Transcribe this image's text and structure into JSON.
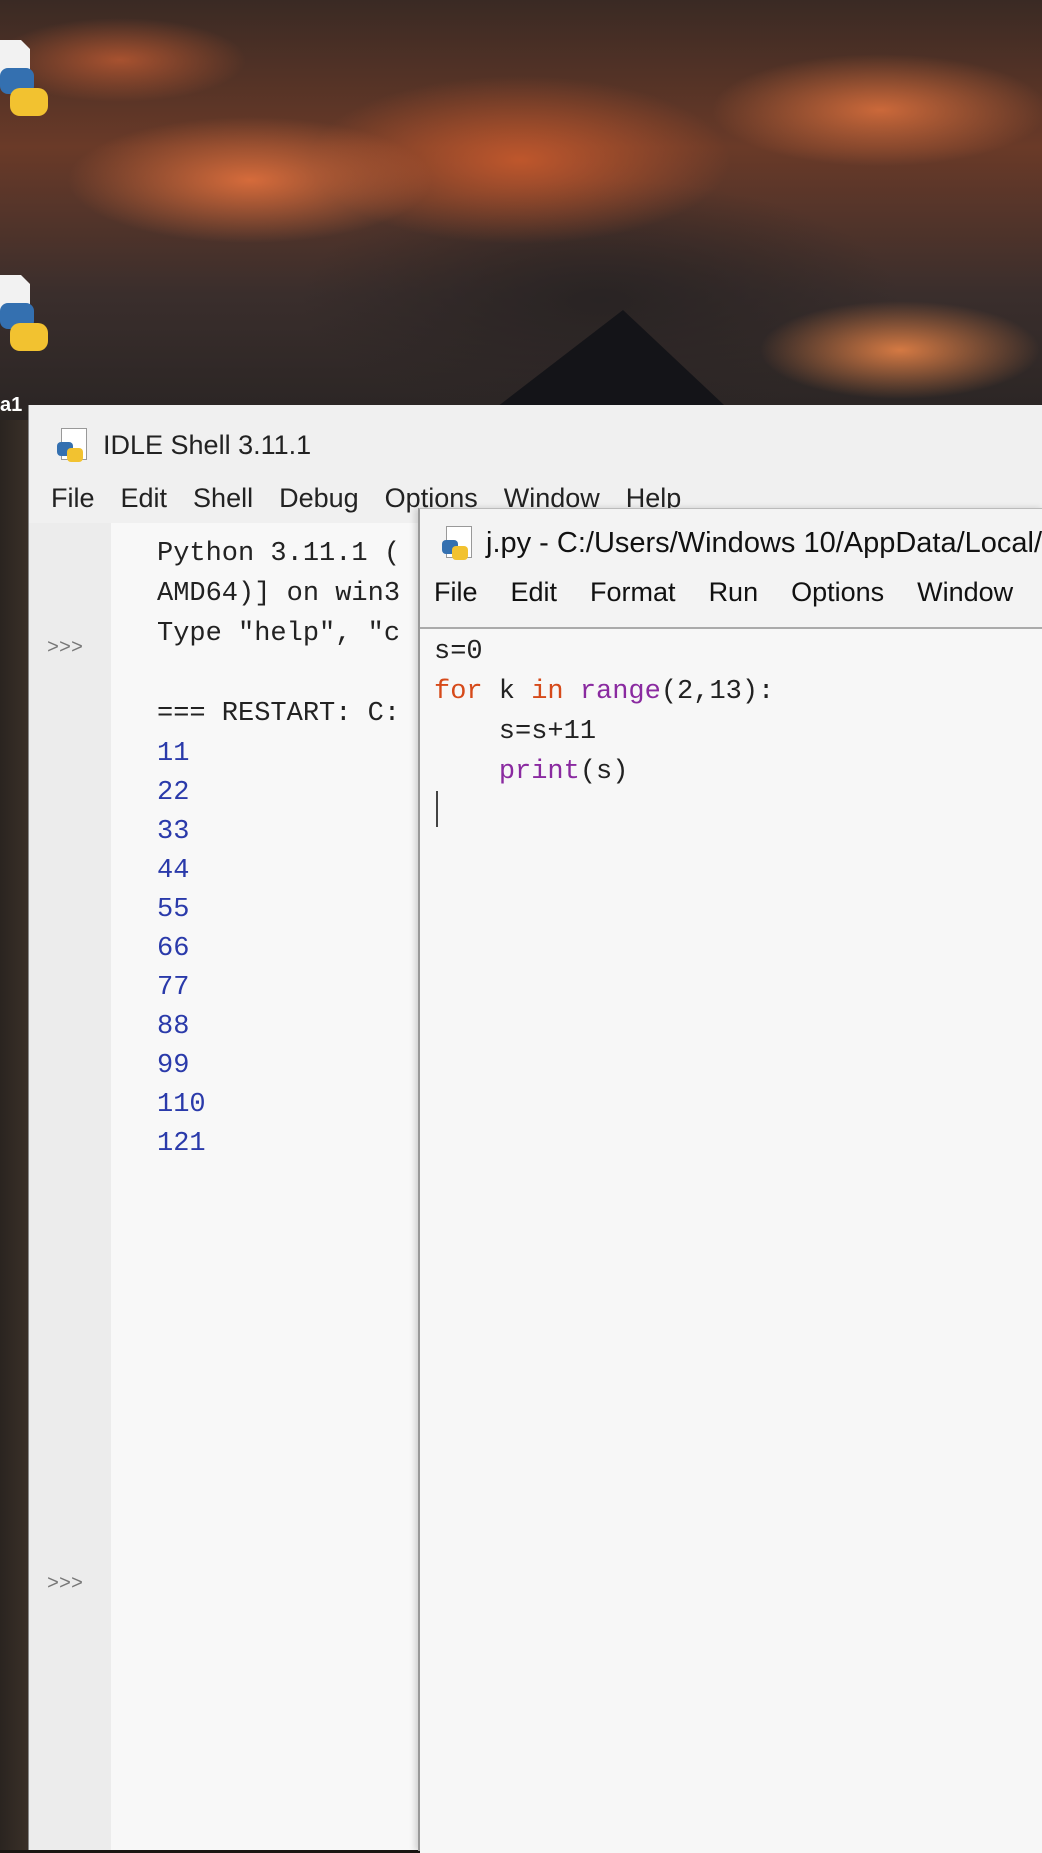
{
  "desktop": {
    "icon_label": "a1"
  },
  "shell": {
    "title": "IDLE Shell 3.11.1",
    "menu": [
      "File",
      "Edit",
      "Shell",
      "Debug",
      "Options",
      "Window",
      "Help"
    ],
    "banner": [
      "Python 3.11.1 (",
      "AMD64)] on win3",
      "Type \"help\", \"c"
    ],
    "prompt": ">>>",
    "restart": "=== RESTART: C:",
    "output": [
      "11",
      "22",
      "33",
      "44",
      "55",
      "66",
      "77",
      "88",
      "99",
      "110",
      "121"
    ]
  },
  "editor": {
    "title": "j.py - C:/Users/Windows 10/AppData/Local/",
    "menu": [
      "File",
      "Edit",
      "Format",
      "Run",
      "Options",
      "Window"
    ],
    "code": {
      "line1": "s=0",
      "line2_kw": "for",
      "line2_mid": " k ",
      "line2_kw2": "in",
      "line2_sp": " ",
      "line2_bi": "range",
      "line2_rest": "(2,13):",
      "line3": "    s=s+11",
      "line4_indent": "    ",
      "line4_bi": "print",
      "line4_rest": "(s)"
    }
  }
}
